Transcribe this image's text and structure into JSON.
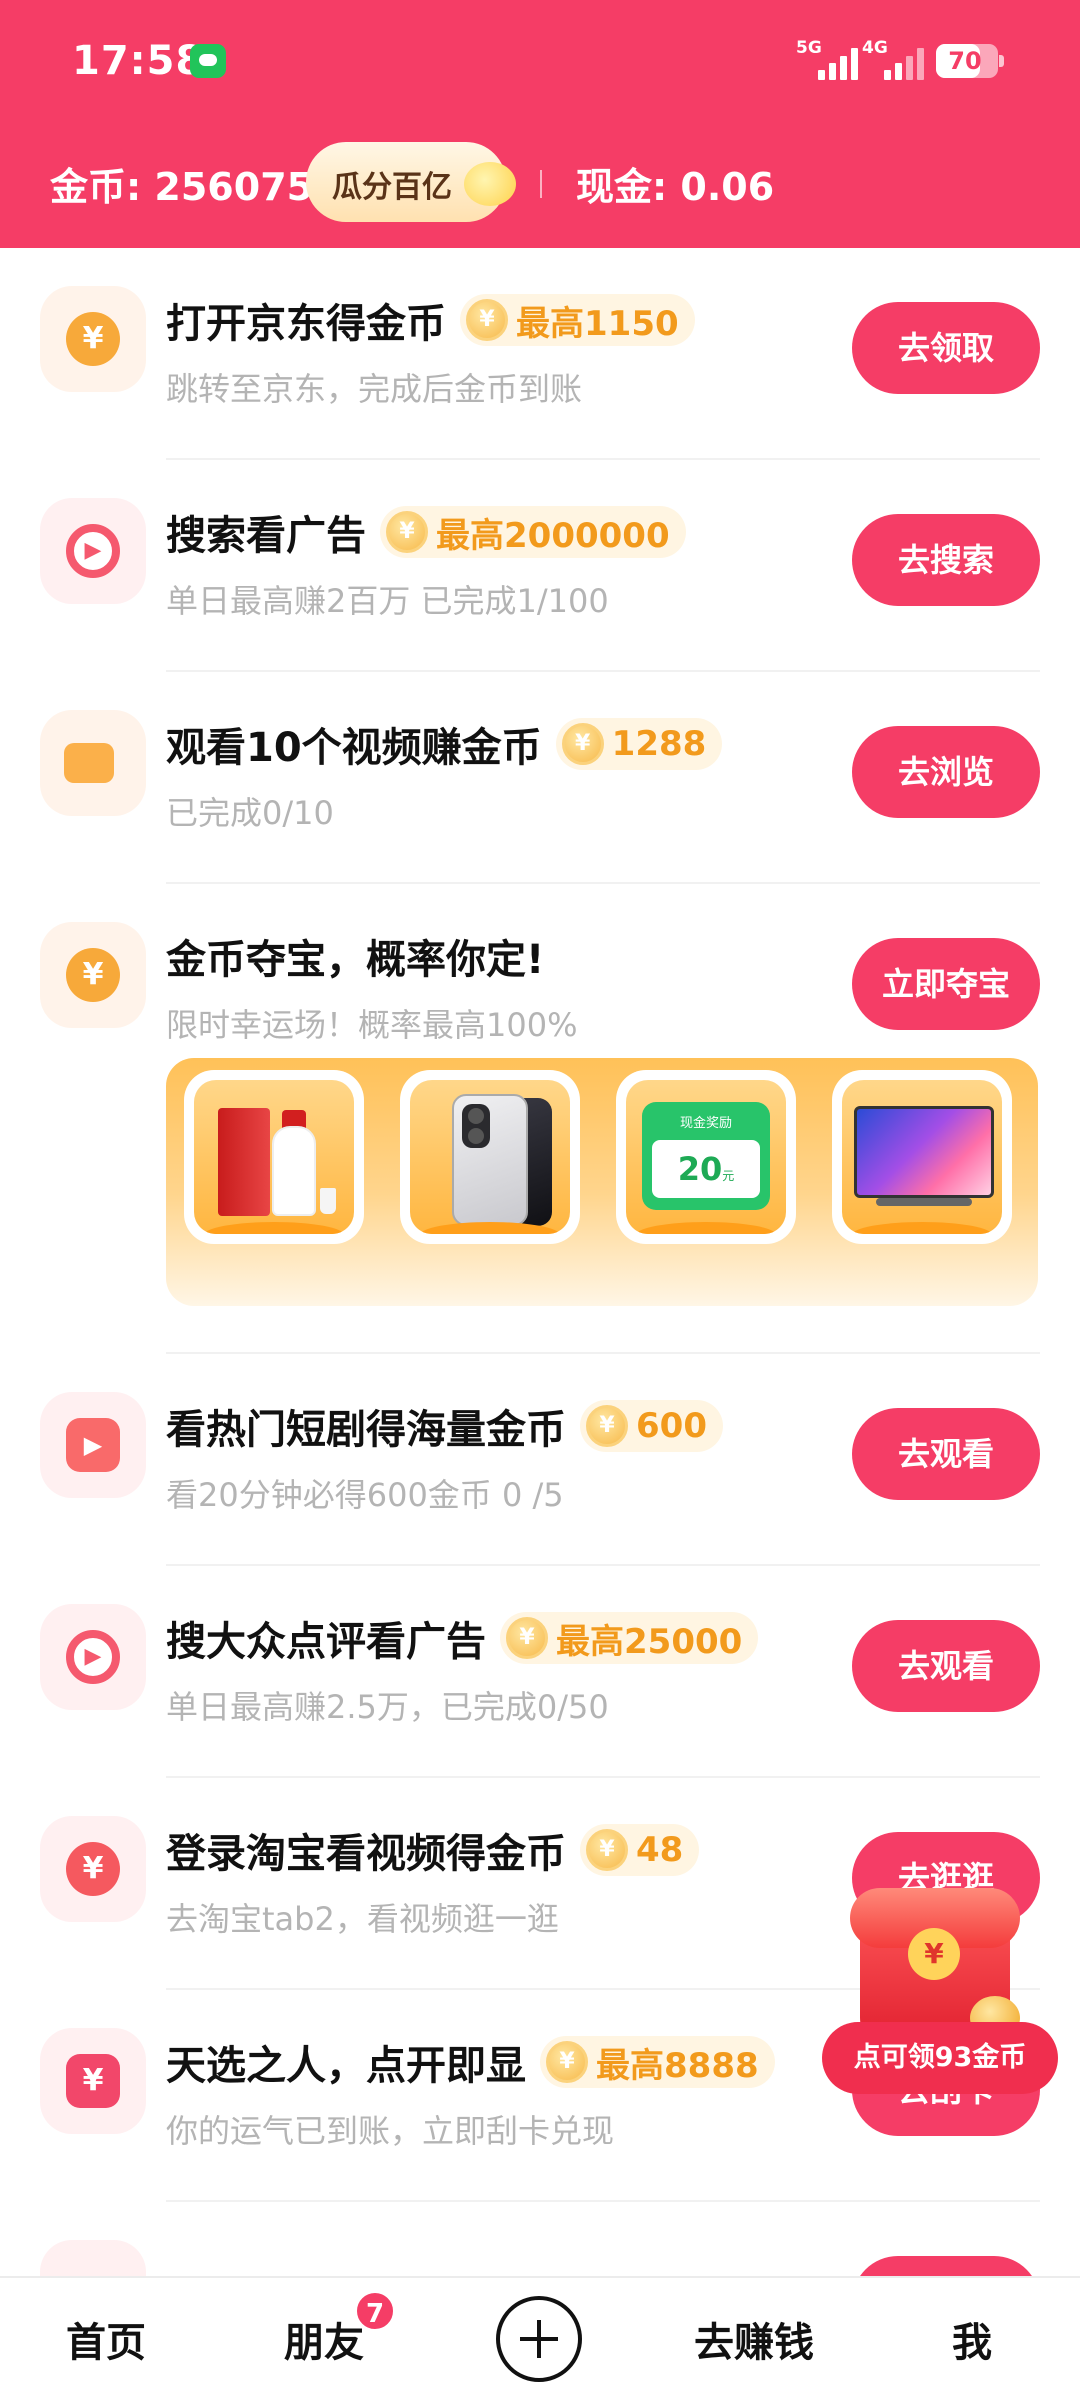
{
  "status_bar": {
    "time": "17:58",
    "network_1": "5G",
    "network_2": "4G",
    "battery": "70"
  },
  "header": {
    "coins_label": "金币: 256075",
    "split_button": "瓜分百亿",
    "cash_label": "现金: 0.06"
  },
  "tasks": [
    {
      "title": "打开京东得金币",
      "reward": "最高1150",
      "subtitle": "跳转至京东，完成后金币到账",
      "button": "去领取",
      "icon": "jd-coin-icon"
    },
    {
      "title": "搜索看广告",
      "reward": "最高2000000",
      "subtitle": "单日最高赚2百万 已完成1/100",
      "button": "去搜索",
      "icon": "search-play-icon"
    },
    {
      "title": "观看10个视频赚金币",
      "reward": "1288",
      "subtitle": "已完成0/10",
      "button": "去浏览",
      "icon": "video-camera-icon"
    },
    {
      "title": "金币夺宝，概率你定!",
      "reward": "",
      "subtitle": "限时幸运场！概率最高100%",
      "button": "立即夺宝",
      "icon": "treasure-coin-icon"
    },
    {
      "title": "看热门短剧得海量金币",
      "reward": "600",
      "subtitle": "看20分钟必得600金币 0 /5",
      "button": "去观看",
      "icon": "tv-play-icon"
    },
    {
      "title": "搜大众点评看广告",
      "reward": "最高25000",
      "subtitle": "单日最高赚2.5万，已完成0/50",
      "button": "去观看",
      "icon": "search-play-icon"
    },
    {
      "title": "登录淘宝看视频得金币",
      "reward": "48",
      "subtitle": "去淘宝tab2，看视频逛一逛",
      "button": "去逛逛",
      "icon": "money-bag-icon"
    },
    {
      "title": "天选之人，点开即显",
      "reward": "最高8888",
      "subtitle": "你的运气已到账，立即刮卡兑现",
      "button": "去刮卡",
      "icon": "lucky-card-icon"
    }
  ],
  "prize_banner": {
    "items": [
      "baijiu-prize",
      "phone-prize",
      "cash-prize",
      "tv-prize"
    ],
    "cash_card_header": "现金奖励",
    "cash_card_amount": "20",
    "cash_card_unit": "元"
  },
  "floating_redpack": {
    "label": "点可领93金币"
  },
  "bottom_nav": {
    "home": "首页",
    "friends": "朋友",
    "friends_badge": "7",
    "earn": "去赚钱",
    "me": "我"
  },
  "colors": {
    "brand": "#f53d66",
    "reward_text": "#f29a1c",
    "subtitle": "#b4b4b4"
  }
}
